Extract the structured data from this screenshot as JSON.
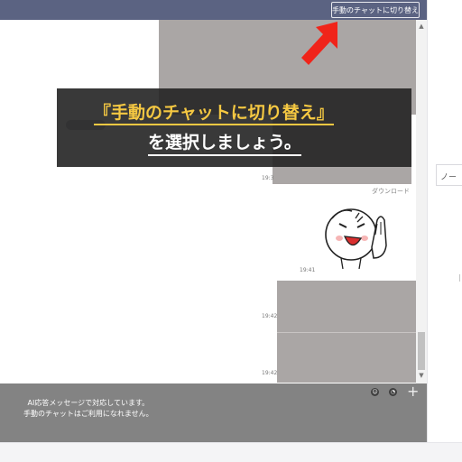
{
  "header": {
    "switch_button_label": "手動のチャットに切り替え"
  },
  "overlay": {
    "line1": "『手動のチャットに切り替え』",
    "line2": "を選択しましょう。"
  },
  "messages": [
    {
      "time": "19:3"
    },
    {
      "time": "19:41"
    },
    {
      "time": "19:42"
    },
    {
      "time": "19:42"
    }
  ],
  "download_label": "ダウンロード",
  "right_panel": {
    "tab_label": "ノー"
  },
  "footer": {
    "line1": "AI応答メッセージで対応しています。",
    "line2": "手動のチャットはご利用になれません。"
  },
  "colors": {
    "header_bg": "#5b6382",
    "overlay_highlight": "#f5c842",
    "arrow": "#f0241a",
    "footer_bg": "#838383"
  },
  "icons": [
    "red-arrow-icon",
    "sticker-icon",
    "emoji-icon",
    "chat-bubble-icon",
    "plus-icon"
  ]
}
